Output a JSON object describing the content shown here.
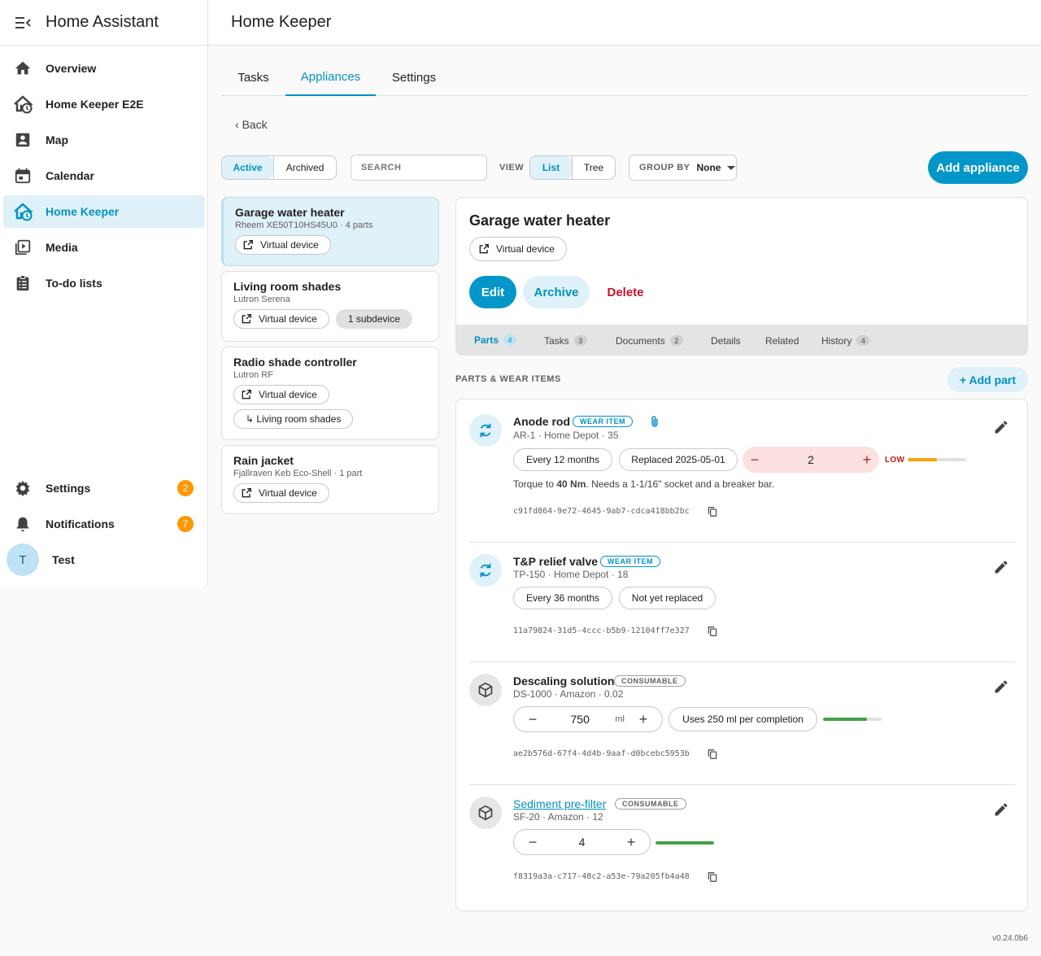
{
  "app": {
    "title": "Home Assistant",
    "version": "v0.24.0b6"
  },
  "sidebar": {
    "items": [
      {
        "label": "Overview",
        "icon": "home-icon"
      },
      {
        "label": "Home Keeper E2E",
        "icon": "home-clock-icon"
      },
      {
        "label": "Map",
        "icon": "map-person-icon"
      },
      {
        "label": "Calendar",
        "icon": "calendar-icon"
      },
      {
        "label": "Home Keeper",
        "icon": "home-clock-icon",
        "active": true
      },
      {
        "label": "Media",
        "icon": "media-icon"
      },
      {
        "label": "To-do lists",
        "icon": "clipboard-list-icon"
      }
    ],
    "settings": {
      "label": "Settings",
      "badge": "2"
    },
    "notifications": {
      "label": "Notifications",
      "badge": "7"
    },
    "user": {
      "initial": "T",
      "name": "Test"
    }
  },
  "header": {
    "title": "Home Keeper"
  },
  "tabs": [
    "Tasks",
    "Appliances",
    "Settings"
  ],
  "back_label": "Back",
  "toolbar": {
    "filter": {
      "active": "Active",
      "archived": "Archived"
    },
    "search_placeholder": "SEARCH",
    "view_label": "VIEW",
    "view": {
      "list": "List",
      "tree": "Tree"
    },
    "group_by_label": "GROUP BY",
    "group_by_value": "None",
    "add_appliance": "Add appliance"
  },
  "appliances": [
    {
      "name": "Garage water heater",
      "sub": "Rheem XE50T10HS45U0 · 4 parts",
      "chip": "Virtual device"
    },
    {
      "name": "Living room shades",
      "sub": "Lutron Serena",
      "chip": "Virtual device",
      "extra": "1 subdevice"
    },
    {
      "name": "Radio shade controller",
      "sub": "Lutron RF",
      "chip": "Virtual device",
      "parent": "↳ Living room shades"
    },
    {
      "name": "Rain jacket",
      "sub": "Fjallraven Keb Eco-Shell · 1 part",
      "chip": "Virtual device"
    }
  ],
  "detail": {
    "title": "Garage water heater",
    "chip": "Virtual device",
    "edit": "Edit",
    "archive": "Archive",
    "delete": "Delete",
    "subtabs": [
      {
        "label": "Parts",
        "count": "4"
      },
      {
        "label": "Tasks",
        "count": "3"
      },
      {
        "label": "Documents",
        "count": "2"
      },
      {
        "label": "Details",
        "count": ""
      },
      {
        "label": "Related",
        "count": ""
      },
      {
        "label": "History",
        "count": "4"
      }
    ]
  },
  "parts_section": {
    "label": "PARTS & WEAR ITEMS",
    "add": "+ Add part"
  },
  "parts": [
    {
      "name": "Anode rod",
      "tag": "WEAR ITEM",
      "sub": "AR-1 · Home Depot · 35",
      "interval": "Every 12 months",
      "replaced": "Replaced 2025-05-01",
      "qty": "2",
      "low_label": "LOW",
      "level": 0.5,
      "note_pre": "Torque to ",
      "note_bold": "40 Nm",
      "note_post": ". Needs a 1-1/16\" socket and a breaker bar.",
      "uuid": "c91fd864-9e72-4645-9ab7-cdca418bb2bc"
    },
    {
      "name": "T&P relief valve",
      "tag": "WEAR ITEM",
      "sub": "TP-150 · Home Depot · 18",
      "interval": "Every 36 months",
      "replaced": "Not yet replaced",
      "uuid": "11a79824-31d5-4ccc-b5b9-12104ff7e327"
    },
    {
      "name": "Descaling solution",
      "tag": "CONSUMABLE",
      "sub": "DS-1000 · Amazon · 0.02",
      "qty": "750",
      "unit": "ml",
      "usage": "Uses 250 ml per completion",
      "level": 0.75,
      "uuid": "ae2b576d-67f4-4d4b-9aaf-d0bcebc5953b"
    },
    {
      "name": "Sediment pre-filter",
      "tag": "CONSUMABLE",
      "sub": "SF-20 · Amazon · 12",
      "qty": "4",
      "level": 1.0,
      "uuid": "f8319a3a-c717-48c2-a53e-79a205fb4a48"
    }
  ],
  "colors": {
    "accent": "#0391c4",
    "low": "#ffa000",
    "ok": "#43a047",
    "badge": "#ff9800",
    "delete": "#c8102e"
  }
}
